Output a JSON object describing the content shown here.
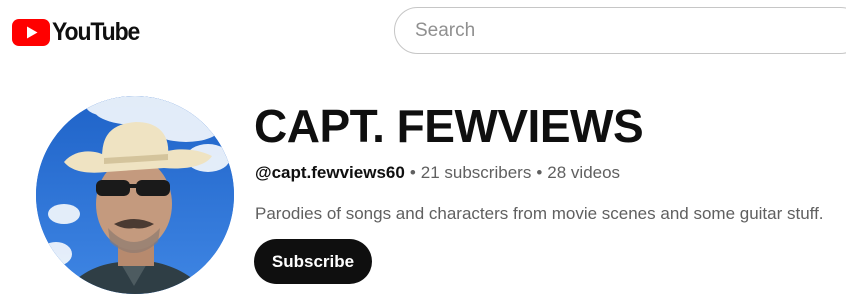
{
  "header": {
    "logo_text": "YouTube",
    "logo_icon": "youtube-play-icon",
    "brand_color": "#ff0000",
    "search": {
      "placeholder": "Search",
      "value": ""
    }
  },
  "channel": {
    "avatar": "channel-avatar-cowboy-hat-portrait",
    "name": "CAPT. FEWVIEWS",
    "handle": "@capt.fewviews60",
    "separator": "•",
    "subscribers": "21 subscribers",
    "videos": "28 videos",
    "description": "Parodies of songs and characters from movie scenes and some guitar stuff.",
    "subscribe_label": "Subscribe"
  }
}
